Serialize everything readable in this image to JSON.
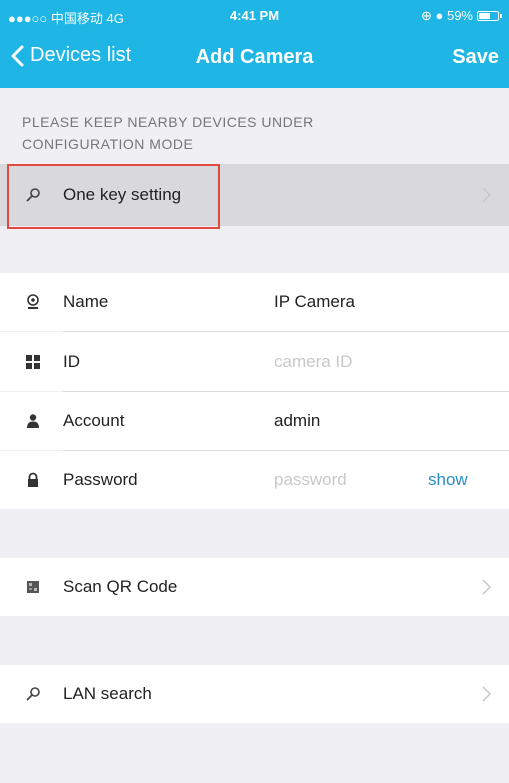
{
  "status_bar": {
    "carrier": "●●●○○ 中国移动 4G",
    "time": "4:41 PM",
    "indicators": "⊕ ● 59%",
    "battery_level": 0.59
  },
  "nav": {
    "back_label": "Devices list",
    "title": "Add Camera",
    "save_label": "Save"
  },
  "hint": "PLEASE KEEP NEARBY DEVICES UNDER CONFIGURATION MODE",
  "one_key": {
    "label": "One key setting"
  },
  "form": {
    "name": {
      "label": "Name",
      "value": "IP Camera"
    },
    "id": {
      "label": "ID",
      "placeholder": "camera ID"
    },
    "account": {
      "label": "Account",
      "value": "admin"
    },
    "password": {
      "label": "Password",
      "placeholder": "password",
      "show_label": "show"
    }
  },
  "scan_qr": {
    "label": "Scan QR Code"
  },
  "lan_search": {
    "label": "LAN search"
  },
  "colors": {
    "header": "#1fb5e4",
    "highlight_border": "#e04a40",
    "link": "#2a8ec4",
    "background": "#efeff4"
  }
}
